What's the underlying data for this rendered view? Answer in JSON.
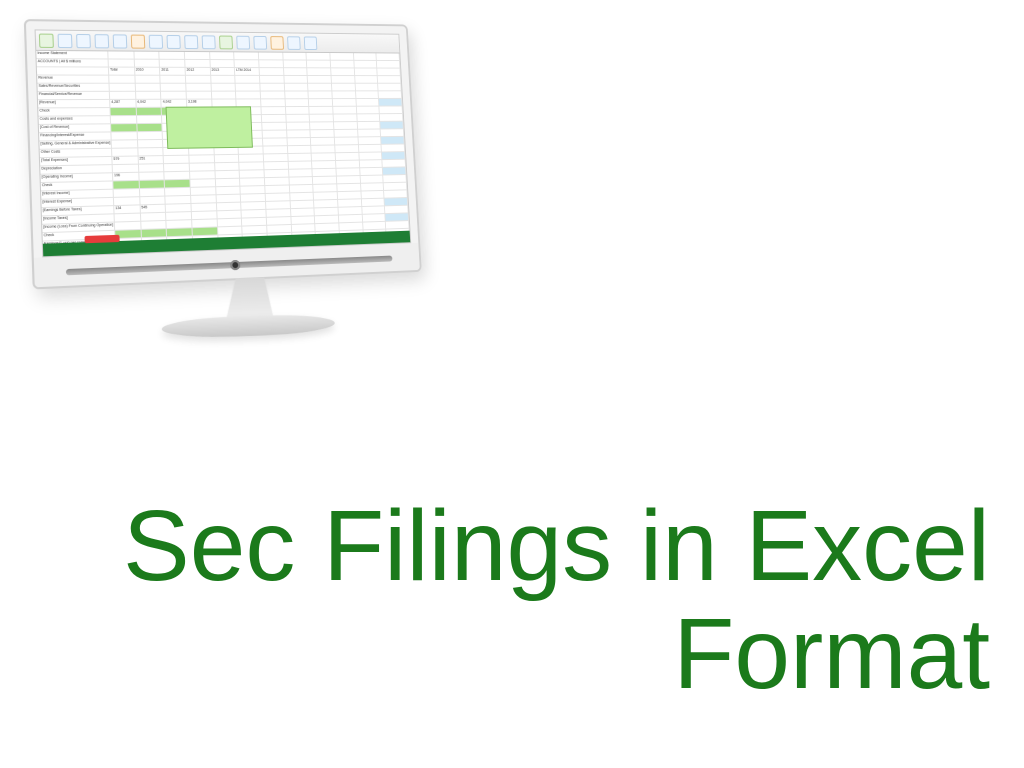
{
  "headline": {
    "line1": "Sec Filings in Excel",
    "line2": "Format"
  },
  "spreadsheet": {
    "title": "Income Statement",
    "subtitle": "ACCOUNTS | All $ millions",
    "rows": [
      "Revenue",
      "Sales/Revenue/Securities",
      "Financial/Service/Revenue",
      "[Revenue]",
      "Check",
      "Costs and expenses",
      "[Cost of Revenue]",
      "Financing/Interest/Expense",
      "[Selling, General & Administrative Expense]",
      "Other Costs",
      "[Total Expenses]",
      "Depreciation",
      "[Operating Income]",
      "Check",
      "[Interest Income]",
      "[Interest Expense]",
      "[Earnings Before Taxes]",
      "[Income Taxes]",
      "[Income (Loss) From Continuing Operation]",
      "Check",
      "Earnings/(Loss) per common share"
    ],
    "year_headers": [
      "Total",
      "2010",
      "2011",
      "2012",
      "2013",
      "LTM 2014"
    ]
  }
}
